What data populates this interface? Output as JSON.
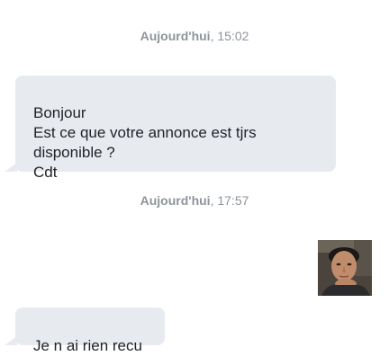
{
  "conversation": {
    "separators": [
      {
        "day": "Aujourd'hui",
        "time": ", 15:02"
      },
      {
        "day": "Aujourd'hui",
        "time": ", 17:57"
      }
    ],
    "messages": [
      {
        "text": "Bonjour\nEst ce que votre annonce est tjrs disponible ?\nCdt"
      },
      {
        "text": "Je n ai rien recu"
      }
    ],
    "avatar": {
      "icon": "user-photo"
    }
  },
  "colors": {
    "bubble_bg": "#e7ebf0",
    "timestamp_text": "#8e949b",
    "message_text": "#1f2328"
  }
}
